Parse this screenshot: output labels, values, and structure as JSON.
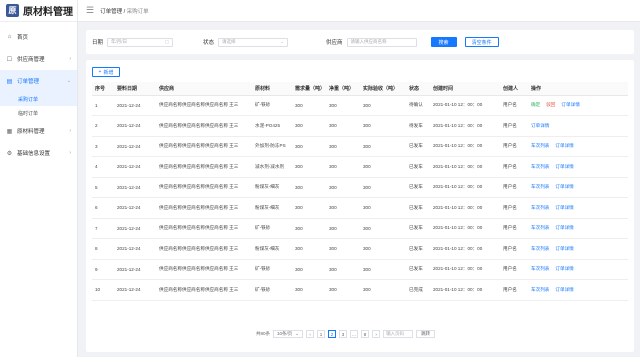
{
  "app": {
    "logo_text": "原材料管理",
    "logo_glyph": "原"
  },
  "sidebar": {
    "items": [
      {
        "label": "首页",
        "icon": "home-icon"
      },
      {
        "label": "供应商管理",
        "icon": "supplier-icon",
        "arrow": "›"
      },
      {
        "label": "订单管理",
        "icon": "order-icon",
        "arrow": "⌄"
      },
      {
        "label": "原材料管理",
        "icon": "material-icon",
        "arrow": "›"
      },
      {
        "label": "基础信息设置",
        "icon": "settings-icon",
        "arrow": "›"
      }
    ],
    "sub_items": [
      {
        "label": "采购订单",
        "active": true
      },
      {
        "label": "临时订单",
        "active": false
      }
    ]
  },
  "breadcrumb": {
    "parent": "订单管理 / ",
    "current": "采购订单"
  },
  "filter": {
    "date_label": "日期",
    "date_placeholder": "年/月/日",
    "status_label": "状态",
    "status_placeholder": "请选择",
    "supplier_label": "供应商",
    "supplier_placeholder": "请输入供应商名称",
    "search_btn": "搜索",
    "reset_btn": "清空条件"
  },
  "table": {
    "add_btn": "新增",
    "columns": [
      "序号",
      "要料日期",
      "供应商",
      "原材料",
      "需求量（吨）",
      "净重（吨）",
      "实际验收（吨）",
      "状态",
      "创建时间",
      "创建人",
      "操作"
    ],
    "rows": [
      {
        "no": "1",
        "date": "2021-12-24",
        "supplier": "供应商名称供应商名称供应商名称 王三",
        "material": "矿-铁砂",
        "demand": "300",
        "net": "300",
        "actual": "300",
        "status": "待确认",
        "created": "2021-01-10 12：00：00",
        "creator": "用户名",
        "ops": [
          "确定",
          "驳回",
          "订单详情"
        ]
      },
      {
        "no": "2",
        "date": "2021-12-24",
        "supplier": "供应商名称供应商名称供应商名称 王三",
        "material": "水泥-PO425",
        "demand": "300",
        "net": "300",
        "actual": "300",
        "status": "待发车",
        "created": "2021-01-10 12：00：00",
        "creator": "用户名",
        "ops": [
          "订单详情"
        ]
      },
      {
        "no": "3",
        "date": "2021-12-24",
        "supplier": "供应商名称供应商名称供应商名称 王三",
        "material": "外加剂-防冻PS",
        "demand": "300",
        "net": "300",
        "actual": "300",
        "status": "已发车",
        "created": "2021-01-10 12：00：00",
        "creator": "用户名",
        "ops": [
          "车次列表",
          "订单详情"
        ]
      },
      {
        "no": "4",
        "date": "2021-12-24",
        "supplier": "供应商名称供应商名称供应商名称 王三",
        "material": "减水剂-减水剂",
        "demand": "300",
        "net": "300",
        "actual": "300",
        "status": "已发车",
        "created": "2021-01-10 12：00：00",
        "creator": "用户名",
        "ops": [
          "车次列表",
          "订单详情"
        ]
      },
      {
        "no": "5",
        "date": "2021-12-24",
        "supplier": "供应商名称供应商名称供应商名称 王三",
        "material": "粉煤灰-细灰",
        "demand": "300",
        "net": "300",
        "actual": "300",
        "status": "已发车",
        "created": "2021-01-10 12：00：00",
        "creator": "用户名",
        "ops": [
          "车次列表",
          "订单详情"
        ]
      },
      {
        "no": "6",
        "date": "2021-12-24",
        "supplier": "供应商名称供应商名称供应商名称 王三",
        "material": "粉煤灰-细灰",
        "demand": "300",
        "net": "300",
        "actual": "300",
        "status": "已发车",
        "created": "2021-01-10 12：00：00",
        "creator": "用户名",
        "ops": [
          "车次列表",
          "订单详情"
        ]
      },
      {
        "no": "7",
        "date": "2021-12-24",
        "supplier": "供应商名称供应商名称供应商名称 王三",
        "material": "矿-铁砂",
        "demand": "300",
        "net": "300",
        "actual": "300",
        "status": "已发车",
        "created": "2021-01-10 12：00：00",
        "creator": "用户名",
        "ops": [
          "车次列表",
          "订单详情"
        ]
      },
      {
        "no": "8",
        "date": "2021-12-24",
        "supplier": "供应商名称供应商名称供应商名称 王三",
        "material": "粉煤灰-细灰",
        "demand": "300",
        "net": "300",
        "actual": "300",
        "status": "已发车",
        "created": "2021-01-10 12：00：00",
        "creator": "用户名",
        "ops": [
          "车次列表",
          "订单详情"
        ]
      },
      {
        "no": "9",
        "date": "2021-12-24",
        "supplier": "供应商名称供应商名称供应商名称 王三",
        "material": "矿-铁砂",
        "demand": "300",
        "net": "300",
        "actual": "300",
        "status": "已发车",
        "created": "2021-01-10 12：00：00",
        "creator": "用户名",
        "ops": [
          "车次列表",
          "订单详情"
        ]
      },
      {
        "no": "10",
        "date": "2021-12-24",
        "supplier": "供应商名称供应商名称供应商名称 王三",
        "material": "矿-铁砂",
        "demand": "300",
        "net": "300",
        "actual": "300",
        "status": "已完成",
        "created": "2021-01-10 12：00：00",
        "creator": "用户名",
        "ops": [
          "车次列表",
          "订单详情"
        ]
      }
    ]
  },
  "pager": {
    "total": "共80条",
    "page_size": "10条/页",
    "prev": "‹",
    "pages": [
      "1",
      "2",
      "3",
      "...",
      "8"
    ],
    "active": "2",
    "next": "›",
    "jump_placeholder": "输入页码",
    "jump_btn": "跳转"
  },
  "colors": {
    "primary": "#1677ff",
    "confirm": "#27ae60",
    "reject": "#e74c3c"
  }
}
